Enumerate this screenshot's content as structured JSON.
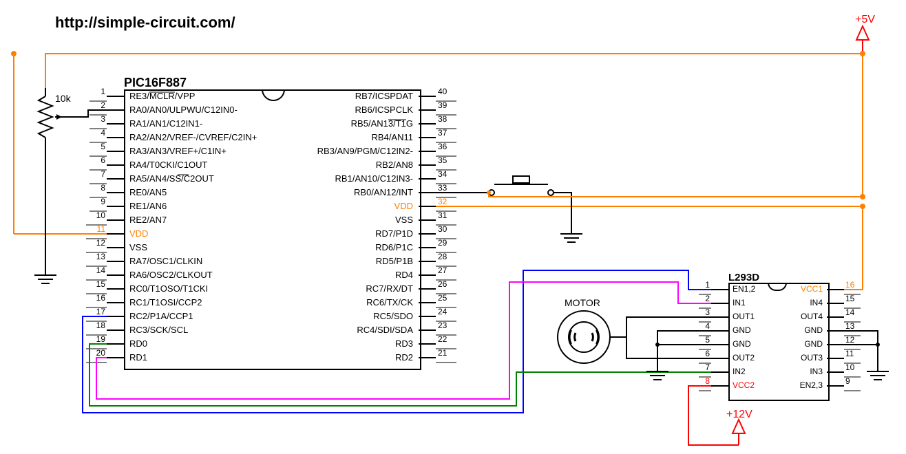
{
  "url": "http://simple-circuit.com/",
  "ic1": {
    "title": "PIC16F887",
    "left_pins": [
      {
        "n": "1",
        "label": "RE3/MCLR/VPP",
        "over": "MCLR"
      },
      {
        "n": "2",
        "label": "RA0/AN0/ULPWU/C12IN0-"
      },
      {
        "n": "3",
        "label": "RA1/AN1/C12IN1-"
      },
      {
        "n": "4",
        "label": "RA2/AN2/VREF-/CVREF/C2IN+"
      },
      {
        "n": "5",
        "label": "RA3/AN3/VREF+/C1IN+"
      },
      {
        "n": "6",
        "label": "RA4/T0CKI/C1OUT"
      },
      {
        "n": "7",
        "label": "RA5/AN4/SS/C2OUT",
        "over": "SS"
      },
      {
        "n": "8",
        "label": "RE0/AN5"
      },
      {
        "n": "9",
        "label": "RE1/AN6"
      },
      {
        "n": "10",
        "label": "RE2/AN7"
      },
      {
        "n": "11",
        "label": "VDD",
        "cls": "vdd"
      },
      {
        "n": "12",
        "label": "VSS"
      },
      {
        "n": "13",
        "label": "RA7/OSC1/CLKIN"
      },
      {
        "n": "14",
        "label": "RA6/OSC2/CLKOUT"
      },
      {
        "n": "15",
        "label": "RC0/T1OSO/T1CKI"
      },
      {
        "n": "16",
        "label": "RC1/T1OSI/CCP2"
      },
      {
        "n": "17",
        "label": "RC2/P1A/CCP1"
      },
      {
        "n": "18",
        "label": "RC3/SCK/SCL"
      },
      {
        "n": "19",
        "label": "RD0"
      },
      {
        "n": "20",
        "label": "RD1"
      }
    ],
    "right_pins": [
      {
        "n": "40",
        "label": "RB7/ICSPDAT"
      },
      {
        "n": "39",
        "label": "RB6/ICSPCLK"
      },
      {
        "n": "38",
        "label": "RB5/AN13/T1G",
        "over": "T1G"
      },
      {
        "n": "37",
        "label": "RB4/AN11"
      },
      {
        "n": "36",
        "label": "RB3/AN9/PGM/C12IN2-"
      },
      {
        "n": "35",
        "label": "RB2/AN8"
      },
      {
        "n": "34",
        "label": "RB1/AN10/C12IN3-"
      },
      {
        "n": "33",
        "label": "RB0/AN12/INT"
      },
      {
        "n": "32",
        "label": "VDD",
        "cls": "vdd"
      },
      {
        "n": "31",
        "label": "VSS"
      },
      {
        "n": "30",
        "label": "RD7/P1D"
      },
      {
        "n": "29",
        "label": "RD6/P1C"
      },
      {
        "n": "28",
        "label": "RD5/P1B"
      },
      {
        "n": "27",
        "label": "RD4"
      },
      {
        "n": "26",
        "label": "RC7/RX/DT"
      },
      {
        "n": "25",
        "label": "RC6/TX/CK"
      },
      {
        "n": "24",
        "label": "RC5/SDO"
      },
      {
        "n": "23",
        "label": "RC4/SDI/SDA"
      },
      {
        "n": "22",
        "label": "RD3"
      },
      {
        "n": "21",
        "label": "RD2"
      }
    ]
  },
  "ic2": {
    "title": "L293D",
    "left_pins": [
      {
        "n": "1",
        "label": "EN1,2"
      },
      {
        "n": "2",
        "label": "IN1"
      },
      {
        "n": "3",
        "label": "OUT1"
      },
      {
        "n": "4",
        "label": "GND"
      },
      {
        "n": "5",
        "label": "GND"
      },
      {
        "n": "6",
        "label": "OUT2"
      },
      {
        "n": "7",
        "label": "IN2"
      },
      {
        "n": "8",
        "label": "VCC2",
        "cls": "red"
      }
    ],
    "right_pins": [
      {
        "n": "16",
        "label": "VCC1",
        "cls": "vdd"
      },
      {
        "n": "15",
        "label": "IN4"
      },
      {
        "n": "14",
        "label": "OUT4"
      },
      {
        "n": "13",
        "label": "GND"
      },
      {
        "n": "12",
        "label": "GND"
      },
      {
        "n": "11",
        "label": "OUT3"
      },
      {
        "n": "10",
        "label": "IN3"
      },
      {
        "n": "9",
        "label": "EN2,3"
      }
    ]
  },
  "labels": {
    "pot": "10k",
    "motor": "MOTOR",
    "v5": "+5V",
    "v12": "+12V"
  },
  "colors": {
    "orange": "#ff8000",
    "blue": "#0000ff",
    "green": "#008000",
    "magenta": "#ff00ff",
    "red": "#ff0000",
    "black": "#000000"
  }
}
